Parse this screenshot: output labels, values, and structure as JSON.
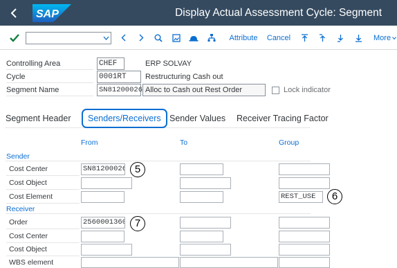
{
  "titlebar": {
    "app_title": "Display Actual Assessment Cycle: Segment",
    "logo_text": "SAP"
  },
  "toolbar": {
    "command_field_value": "",
    "attribute_label": "Attribute",
    "cancel_label": "Cancel",
    "more_label": "More"
  },
  "header": {
    "controlling_area": {
      "label": "Controlling Area",
      "value": "CHEF",
      "description": "ERP SOLVAY"
    },
    "cycle": {
      "label": "Cycle",
      "value": "0001RT",
      "description": "Restructuring Cash out"
    },
    "segment_name": {
      "label": "Segment Name",
      "value": "SN81200026",
      "description": "Alloc to Cash out Rest Order"
    },
    "lock_indicator_label": "Lock indicator"
  },
  "tabs": [
    {
      "label": "Segment Header",
      "active": false
    },
    {
      "label": "Senders/Receivers",
      "active": true
    },
    {
      "label": "Sender Values",
      "active": false
    },
    {
      "label": "Receiver Tracing Factor",
      "active": false
    }
  ],
  "grid": {
    "columns": {
      "from": "From",
      "to": "To",
      "group": "Group"
    },
    "sender_section": "Sender",
    "receiver_section": "Receiver",
    "sender_rows": [
      {
        "label": "Cost Center",
        "from": "SN81200026",
        "to": "",
        "group": ""
      },
      {
        "label": "Cost Object",
        "from": "",
        "to": "",
        "group": ""
      },
      {
        "label": "Cost Element",
        "from": "",
        "to": "",
        "group": "REST_USE"
      }
    ],
    "receiver_rows": [
      {
        "label": "Order",
        "from": "2560001360",
        "to": "",
        "group": ""
      },
      {
        "label": "Cost Center",
        "from": "",
        "to": "",
        "group": ""
      },
      {
        "label": "Cost Object",
        "from": "",
        "to": "",
        "group": ""
      },
      {
        "label": "WBS element",
        "from": "",
        "to": "",
        "group": ""
      }
    ]
  },
  "callouts": {
    "c5": "5",
    "c6": "6",
    "c7": "7"
  },
  "colors": {
    "shell_bar": "#354a5f",
    "accent": "#0a6ed1",
    "confirm_green": "#107e3e"
  }
}
